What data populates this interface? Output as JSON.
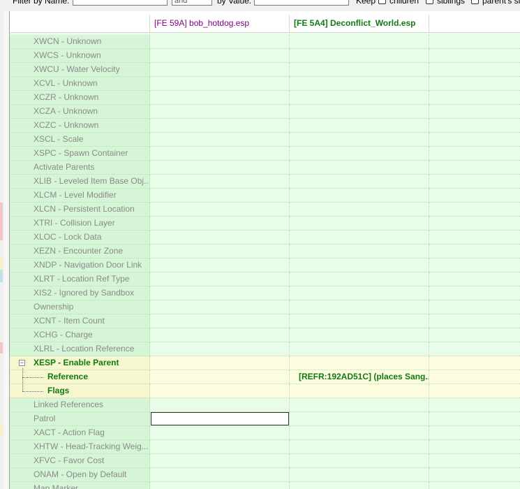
{
  "filter": {
    "by_name_label": "Filter by Name:",
    "name_value": "",
    "conjunction": "and",
    "by_value_label": "by Value:",
    "value_value": "",
    "keep_label": "Keep",
    "children_label": "children",
    "siblings_label": "siblings",
    "parent_label": "parent's si"
  },
  "columns": [
    {
      "label": ""
    },
    {
      "label": "[FE 59A] bob_hotdog.esp"
    },
    {
      "label": "[FE 5A4] Deconflict_World.esp"
    },
    {
      "label": ""
    }
  ],
  "rows": [
    {
      "label": "XWCN - Unknown"
    },
    {
      "label": "XWCS - Unknown"
    },
    {
      "label": "XWCU - Water Velocity"
    },
    {
      "label": "XCVL - Unknown"
    },
    {
      "label": "XCZR - Unknown"
    },
    {
      "label": "XCZA - Unknown"
    },
    {
      "label": "XCZC - Unknown"
    },
    {
      "label": "XSCL - Scale"
    },
    {
      "label": "XSPC - Spawn Container"
    },
    {
      "label": "Activate Parents"
    },
    {
      "label": "XLIB - Leveled Item Base Obj..."
    },
    {
      "label": "XLCM - Level Modifier"
    },
    {
      "label": "XLCN - Persistent Location"
    },
    {
      "label": "XTRI - Collision Layer"
    },
    {
      "label": "XLOC - Lock Data"
    },
    {
      "label": "XEZN - Encounter Zone"
    },
    {
      "label": "XNDP - Navigation Door Link"
    },
    {
      "label": "XLRT - Location Ref Type"
    },
    {
      "label": "XIS2 - Ignored by Sandbox"
    },
    {
      "label": "Ownership"
    },
    {
      "label": "XCNT - Item Count"
    },
    {
      "label": "XCHG - Charge"
    },
    {
      "label": "XLRL - Location Reference"
    }
  ],
  "xesp": {
    "label": "XESP - Enable Parent",
    "toggle": "−",
    "children": [
      {
        "label": "Reference",
        "deconflict_value": "[REFR:192AD51C] (places Sang..."
      },
      {
        "label": "Flags",
        "deconflict_value": ""
      }
    ]
  },
  "rows_after": [
    {
      "label": "Linked References"
    },
    {
      "label": "Patrol"
    },
    {
      "label": "XACT - Action Flag"
    },
    {
      "label": "XHTW - Head-Tracking Weig..."
    },
    {
      "label": "XFVC - Favor Cost"
    },
    {
      "label": "ONAM - Open by Default"
    },
    {
      "label": "Map Marker"
    }
  ]
}
